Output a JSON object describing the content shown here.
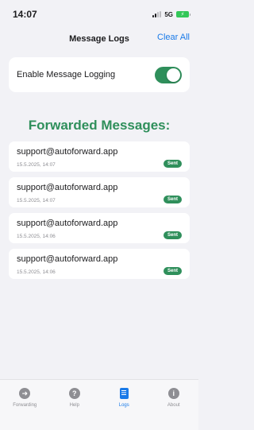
{
  "status": {
    "time": "14:07",
    "network": "5G",
    "battery_color": "#34c759"
  },
  "nav": {
    "title": "Message Logs",
    "action_label": "Clear All"
  },
  "settings": {
    "toggle_label": "Enable Message Logging",
    "toggle_on": true
  },
  "section_title": "Forwarded Messages:",
  "logs": [
    {
      "email": "support@autoforward.app",
      "time": "15.5.2025, 14:07",
      "status": "Sent"
    },
    {
      "email": "support@autoforward.app",
      "time": "15.5.2025, 14:07",
      "status": "Sent"
    },
    {
      "email": "support@autoforward.app",
      "time": "15.5.2025, 14:06",
      "status": "Sent"
    },
    {
      "email": "support@autoforward.app",
      "time": "15.5.2025, 14:06",
      "status": "Sent"
    }
  ],
  "tabs": [
    {
      "label": "Forwarding",
      "icon": "arrow-right-circle-icon",
      "active": false
    },
    {
      "label": "Help",
      "icon": "question-circle-icon",
      "active": false
    },
    {
      "label": "Logs",
      "icon": "book-icon",
      "active": true
    },
    {
      "label": "About",
      "icon": "info-circle-icon",
      "active": false
    }
  ],
  "colors": {
    "accent_green": "#2f8f5b",
    "accent_blue": "#1a7ae8",
    "inactive_gray": "#8e8e93"
  }
}
